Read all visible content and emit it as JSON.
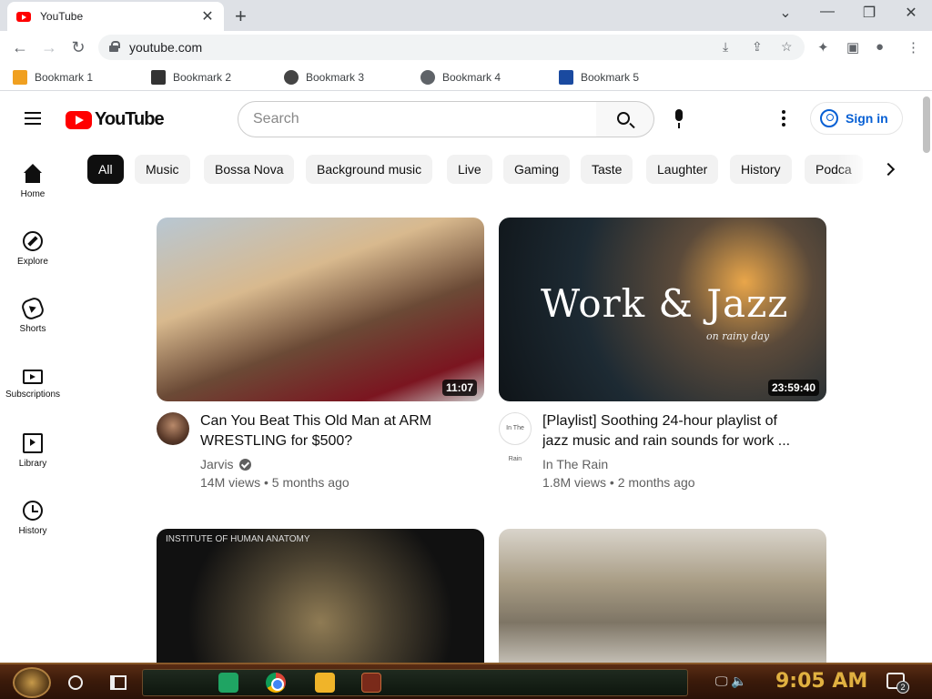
{
  "browser": {
    "tab_title": "YouTube",
    "tab_close": "✕",
    "new_tab": "+",
    "window_controls": {
      "dropdown": "⌄",
      "minimize": "—",
      "restore": "❐",
      "close": "✕"
    },
    "back": "←",
    "forward": "→",
    "reload": "↻",
    "url": "youtube.com",
    "omnibox_icons": {
      "install": "⤓",
      "share": "⇪",
      "bookmark": "☆"
    },
    "toolbar_icons": {
      "extensions": "✦",
      "side_panel": "▣",
      "profile": "●",
      "menu": "⋮"
    }
  },
  "bookmarks": [
    {
      "label": "Bookmark 1"
    },
    {
      "label": "Bookmark 2"
    },
    {
      "label": "Bookmark 3"
    },
    {
      "label": "Bookmark 4"
    },
    {
      "label": "Bookmark 5"
    }
  ],
  "youtube": {
    "logo_text": "YouTube",
    "search_placeholder": "Search",
    "sign_in": "Sign in",
    "chips": [
      "All",
      "Music",
      "Bossa Nova",
      "Background music",
      "Live",
      "Gaming",
      "Taste",
      "Laughter",
      "History",
      "Podca"
    ],
    "guide": [
      {
        "label": "Home",
        "icon": "home-icon"
      },
      {
        "label": "Explore",
        "icon": "explore-icon"
      },
      {
        "label": "Shorts",
        "icon": "shorts-icon"
      },
      {
        "label": "Subscriptions",
        "icon": "subscriptions-icon"
      },
      {
        "label": "Library",
        "icon": "library-icon"
      },
      {
        "label": "History",
        "icon": "history-icon"
      }
    ],
    "videos": [
      {
        "title": "Can You Beat This Old Man at ARM WRESTLING for $500?",
        "channel": "Jarvis",
        "verified": true,
        "meta": "14M views • 5 months ago",
        "duration": "11:07"
      },
      {
        "title": "[Playlist] Soothing 24-hour playlist of jazz music and rain sounds for work ...",
        "channel": "In The Rain",
        "verified": false,
        "meta": "1.8M views • 2 months ago",
        "duration": "23:59:40",
        "thumb_text": "Work & Jazz",
        "thumb_sub": "on rainy day",
        "avatar_text": "In The Rain"
      },
      {
        "thumb_text": "INSTITUTE OF HUMAN ANATOMY"
      },
      {}
    ]
  },
  "taskbar": {
    "clock": "9:05 AM",
    "notification_count": "2",
    "tray": "🖵 🔈"
  }
}
